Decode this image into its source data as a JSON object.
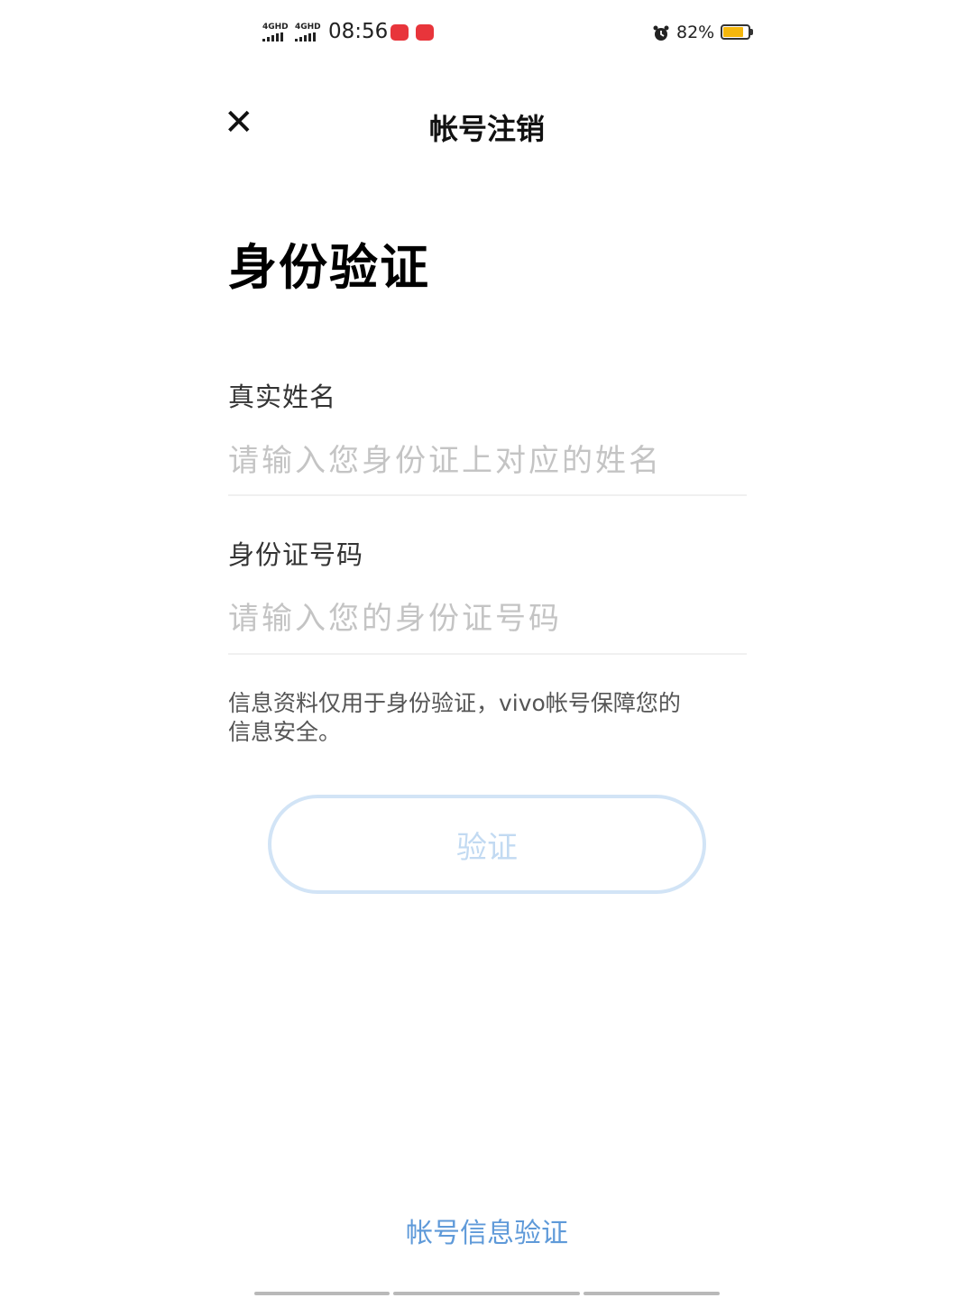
{
  "status_bar": {
    "signal_1": "4GHD",
    "signal_2": "4GHD",
    "time": "08:56",
    "battery_text": "82%",
    "battery_level": 0.82,
    "alarm_icon": "alarm-clock-icon"
  },
  "header": {
    "close_icon": "close-icon",
    "close_glyph": "✕",
    "title": "帐号注销"
  },
  "main": {
    "heading": "身份验证",
    "name_field": {
      "label": "真实姓名",
      "placeholder": "请输入您身份证上对应的姓名",
      "value": ""
    },
    "id_field": {
      "label": "身份证号码",
      "placeholder": "请输入您的身份证号码",
      "value": ""
    },
    "notice_line_1": "信息资料仅用于身份验证，vivo帐号保障您的",
    "notice_line_2": "信息安全。",
    "verify_button": "验证"
  },
  "footer": {
    "link": "帐号信息验证"
  },
  "colors": {
    "accent": "#5f9ad9",
    "button_border_disabled": "#d2e4f6",
    "placeholder": "#c4c4c4",
    "battery": "#f5b70d",
    "badge": "#e8353b"
  }
}
